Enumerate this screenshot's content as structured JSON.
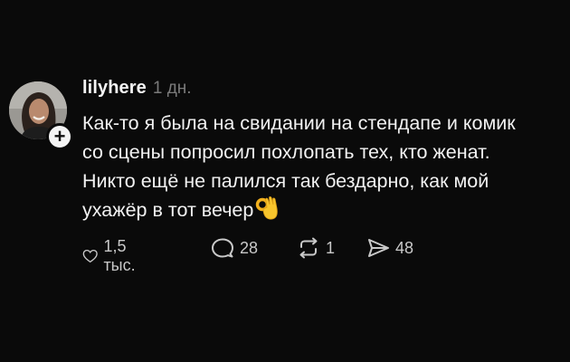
{
  "post": {
    "username": "lilyhere",
    "time": "1 дн.",
    "follow_symbol": "+",
    "text_lines": [
      "Как-то я была на свидании на стендапе и комик",
      "со сцены попросил похлопать тех, кто женат.",
      "Никто ещё не палился так бездарно, как мой",
      "ухажёр в тот вечер"
    ],
    "emoji": "ok-hand-emoji"
  },
  "actions": {
    "like_icon": "heart-icon",
    "like_count": "1,5 тыс.",
    "reply_icon": "speech-bubble-icon",
    "reply_count": "28",
    "repost_icon": "repost-icon",
    "repost_count": "1",
    "share_icon": "send-icon",
    "share_count": "48"
  },
  "colors": {
    "background": "#0a0a0a",
    "text": "#f2f2f2",
    "muted": "#7a7a7a",
    "icon": "#c9c9c9"
  }
}
